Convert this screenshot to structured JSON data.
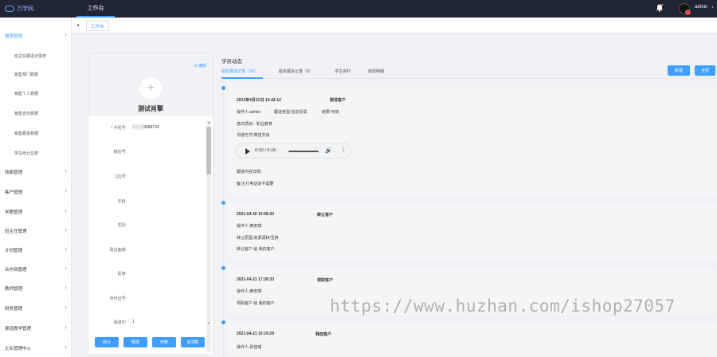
{
  "brand": {
    "name": "万学网"
  },
  "header": {
    "nav_active": "工作台",
    "user_name": "admin",
    "caret": "›"
  },
  "tabs": {
    "arrow": "◂",
    "active": "工作台"
  },
  "sidebar": {
    "items": [
      {
        "label": "报表管理",
        "active": true,
        "chevron": "›"
      },
      {
        "label": "班主任跟进记录表"
      },
      {
        "label": "销售部门数据"
      },
      {
        "label": "销售个人数据"
      },
      {
        "label": "销售省份数据"
      },
      {
        "label": "销售跟进数据"
      },
      {
        "label": "学生统计总表"
      },
      {
        "label": "线索管理",
        "chevron": "›"
      },
      {
        "label": "客户管理",
        "chevron": "›"
      },
      {
        "label": "学籍管理",
        "chevron": "›"
      },
      {
        "label": "班主任管理",
        "chevron": "›"
      },
      {
        "label": "计划管理",
        "chevron": "›"
      },
      {
        "label": "合作商管理",
        "chevron": "›"
      },
      {
        "label": "教师管理",
        "chevron": "›"
      },
      {
        "label": "财务管理",
        "chevron": "›"
      },
      {
        "label": "渠道教学管理",
        "chevron": "›"
      },
      {
        "label": "企业管理中心",
        "chevron": "›"
      }
    ]
  },
  "profile": {
    "edit": "⊘ 编辑",
    "plus": "+",
    "name": "测试肖擎",
    "fields": [
      {
        "label": "* 手机号:",
        "value": "░░░░9586724"
      },
      {
        "label": "微信号:",
        "value": ""
      },
      {
        "label": "QQ号:",
        "value": ""
      },
      {
        "label": "年龄:",
        "value": ""
      },
      {
        "label": "性别:",
        "value": ""
      },
      {
        "label": "政治面貌:",
        "value": ""
      },
      {
        "label": "民族:",
        "value": ""
      },
      {
        "label": "身份证号:",
        "value": ""
      },
      {
        "label": "渠道ID:",
        "value": "1"
      }
    ],
    "scroll_up": "▲",
    "scroll_down": "▼",
    "actions": [
      "转让",
      "释放",
      "作废",
      "未领取"
    ]
  },
  "dynamics": {
    "title": "学员动态",
    "tabs": [
      {
        "label": "招生跟进记录（33）",
        "active": true
      },
      {
        "label": "服务跟进记录（9）"
      },
      {
        "label": "学生资料"
      },
      {
        "label": "缴费明细"
      }
    ],
    "buttons": {
      "new": "新建",
      "more": "全部"
    },
    "records": [
      {
        "time": "2022年4月21日 13:42:12",
        "type": "跟进客户",
        "lines": [
          "操作人:admin",
          "跟进类型:信息反馈",
          "结果:无效",
          "意向项目：职业教育",
          "沟通方式:微信交谈"
        ],
        "audio": {
          "time": "0:00 / 0:18",
          "volume_icon": "🔊",
          "menu_icon": "⋮"
        },
        "footer": [
          "跟进内容详情:",
          "备注:打电话说不需要"
        ]
      },
      {
        "time": "2021-04-30 15:58:20",
        "type": "转让客户",
        "lines": [
          "操作人:黄安琪",
          "转让原因:资源调转/互换",
          "转让客户 给 我的客户"
        ]
      },
      {
        "time": "2021-04-21 17:26:33",
        "type": "领取客户",
        "lines": [
          "操作人:黄安琪",
          "领取客户 给 我的客户"
        ]
      },
      {
        "time": "2021-04-21 10:19:29",
        "type": "释放客户",
        "lines": [
          "操作人:张佳瑶"
        ]
      }
    ]
  },
  "watermark": "https://www.huzhan.com/ishop27057",
  "colors": {
    "accent": "#409eff",
    "topbar": "#1f2533"
  }
}
